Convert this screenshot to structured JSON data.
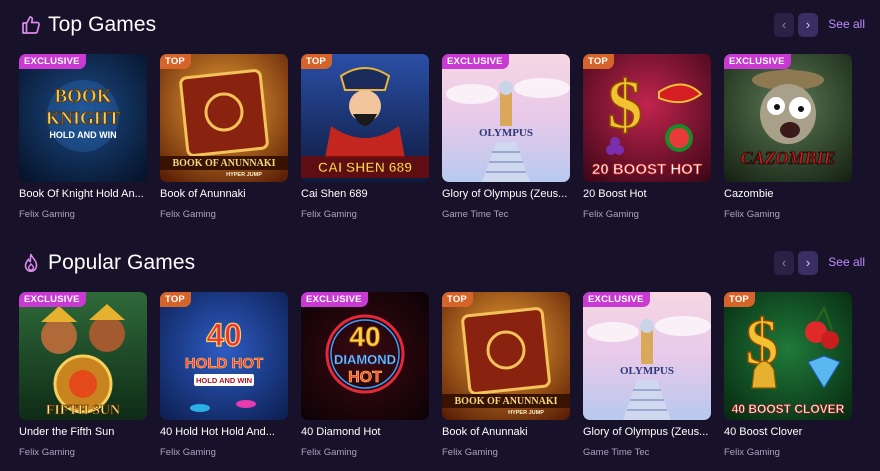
{
  "sections": [
    {
      "title": "Top Games",
      "icon": "thumbs-up-icon",
      "see_all": "See all",
      "prev_symbol": "‹",
      "next_symbol": "›",
      "games": [
        {
          "title": "Book Of Knight Hold An...",
          "provider": "Felix Gaming",
          "badge": "EXCLUSIVE",
          "art_text": [
            "BOOK",
            "KNIGHT",
            "HOLD AND WIN"
          ]
        },
        {
          "title": "Book of Anunnaki",
          "provider": "Felix Gaming",
          "badge": "TOP",
          "art_text": [
            "BOOK OF ANUNNAKI",
            "HYPER JUMP"
          ]
        },
        {
          "title": "Cai Shen 689",
          "provider": "Felix Gaming",
          "badge": "TOP",
          "art_text": [
            "CAI SHEN 689"
          ]
        },
        {
          "title": "Glory of Olympus (Zeus...",
          "provider": "Game Time Tec",
          "badge": "EXCLUSIVE",
          "art_text": [
            "OLYMPUS"
          ]
        },
        {
          "title": "20 Boost Hot",
          "provider": "Felix Gaming",
          "badge": "TOP",
          "art_text": [
            "20 BOOST HOT"
          ]
        },
        {
          "title": "Cazombie",
          "provider": "Felix Gaming",
          "badge": "EXCLUSIVE",
          "art_text": [
            "CAZOMBIE"
          ]
        }
      ]
    },
    {
      "title": "Popular Games",
      "icon": "flame-icon",
      "see_all": "See all",
      "prev_symbol": "‹",
      "next_symbol": "›",
      "games": [
        {
          "title": "Under the Fifth Sun",
          "provider": "Felix Gaming",
          "badge": "EXCLUSIVE",
          "art_text": [
            "FIFTH SUN"
          ]
        },
        {
          "title": "40 Hold Hot Hold And...",
          "provider": "Felix Gaming",
          "badge": "TOP",
          "art_text": [
            "40",
            "HOLD HOT",
            "HOLD AND WIN"
          ]
        },
        {
          "title": "40 Diamond Hot",
          "provider": "Felix Gaming",
          "badge": "EXCLUSIVE",
          "art_text": [
            "40",
            "DIAMOND",
            "HOT"
          ]
        },
        {
          "title": "Book of Anunnaki",
          "provider": "Felix Gaming",
          "badge": "TOP",
          "art_text": [
            "BOOK OF ANUNNAKI",
            "HYPER JUMP"
          ]
        },
        {
          "title": "Glory of Olympus (Zeus...",
          "provider": "Game Time Tec",
          "badge": "EXCLUSIVE",
          "art_text": [
            "OLYMPUS"
          ]
        },
        {
          "title": "40 Boost Clover",
          "provider": "Felix Gaming",
          "badge": "TOP",
          "art_text": [
            "40 BOOST CLOVER"
          ]
        }
      ]
    }
  ],
  "colors": {
    "background": "#17112a",
    "exclusive_badge": "#c93ad2",
    "top_badge": "#d5642a",
    "see_all": "#c08cff",
    "title_icon": "#d98ae8"
  }
}
